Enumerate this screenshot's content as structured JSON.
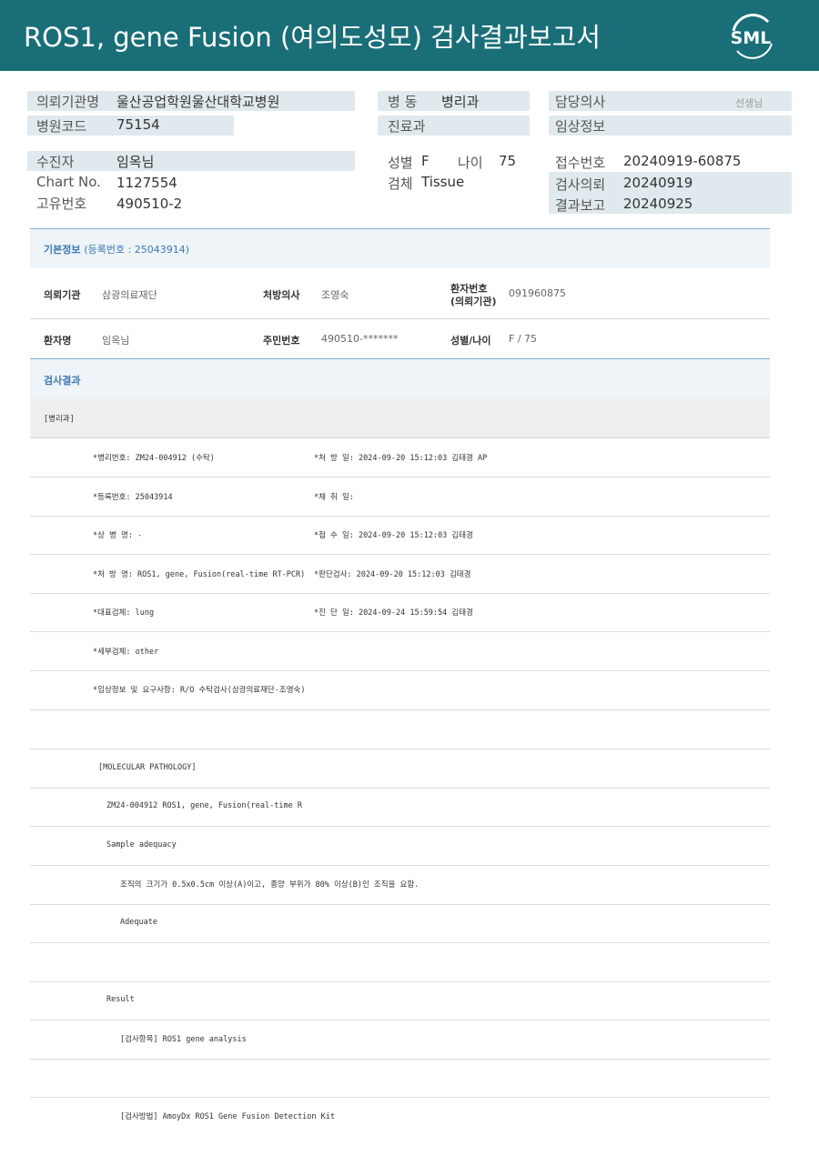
{
  "header": {
    "title": "ROS1, gene Fusion (여의도성모) 검사결과보고서",
    "logo_text": "SML",
    "bg_color": "#196e78"
  },
  "summary": {
    "institution_label": "의뢰기관명",
    "institution_value": "울산공업학원울산대학교병원",
    "ward_label": "병  동",
    "ward_value": "병리과",
    "doctor_label": "담당의사",
    "doctor_suffix": "선생님",
    "hospital_code_label": "병원코드",
    "hospital_code_value": "75154",
    "dept_label": "진료과",
    "clinical_label": "임상정보",
    "patient_label": "수진자",
    "patient_value": "임옥님",
    "sex_label": "성별",
    "sex_value": "F",
    "age_label": "나이",
    "age_value": "75",
    "receipt_label": "접수번호",
    "receipt_value": "20240919-60875",
    "chart_label": "Chart No.",
    "chart_value": "1127554",
    "specimen_label": "검체",
    "specimen_value": "Tissue",
    "request_label": "검사의뢰",
    "request_value": "20240919",
    "unique_label": "고유번호",
    "unique_value": "490510-2",
    "report_label": "결과보고",
    "report_value": "20240925"
  },
  "basic_info": {
    "title": "기본정보",
    "reg_note": "(등록번호 : 25043914)",
    "req_inst_label": "의뢰기관",
    "req_inst_value": "삼광의료재단",
    "prescriber_label": "처방의사",
    "prescriber_value": "조영숙",
    "patient_no_label_1": "환자번호",
    "patient_no_label_2": "(의뢰기관)",
    "patient_no_value": "091960875",
    "patient_name_label": "환자명",
    "patient_name_value": "임옥님",
    "rrn_label": "주민번호",
    "rrn_value": "490510-*******",
    "sex_age_label": "성별/나이",
    "sex_age_value": "F / 75"
  },
  "results": {
    "title": "검사결과",
    "category": "[병리과]",
    "rows_left": [
      "*병리번호: ZM24-004912 (수탁)",
      "*등록번호: 25043914",
      "*상 병 명: -",
      "*처 방 명: ROS1, gene, Fusion(real-time RT-PCR)",
      "*대표검체: lung",
      "*세부검체: other",
      "*임상정보 및 요구사항: R/O 수탁검사(삼광의료재단-조영숙)"
    ],
    "rows_right": [
      "*처 방 일: 2024-09-20 15:12:03  김태경 AP",
      "*채 취 일:",
      "*접 수 일: 2024-09-20 15:12:03  김태경",
      "*판단검사: 2024-09-20 15:12:03  김태경",
      "*진 단 일: 2024-09-24 15:59:54  김태경"
    ],
    "molecular_header": "[MOLECULAR PATHOLOGY]",
    "mol_line": "ZM24-004912     ROS1, gene, Fusion(real-time R",
    "adequacy_title": "Sample adequacy",
    "adequacy_note": "조직의 크기가 0.5x0.5cm 이상(A)이고, 종양 부위가 80% 이상(B)인 조직을 요함.",
    "adequacy_value": "Adequate",
    "result_title": "Result",
    "test_item": "[검사항목] ROS1 gene analysis",
    "test_method": "[검사방법] AmoyDx ROS1 Gene Fusion Detection Kit"
  }
}
